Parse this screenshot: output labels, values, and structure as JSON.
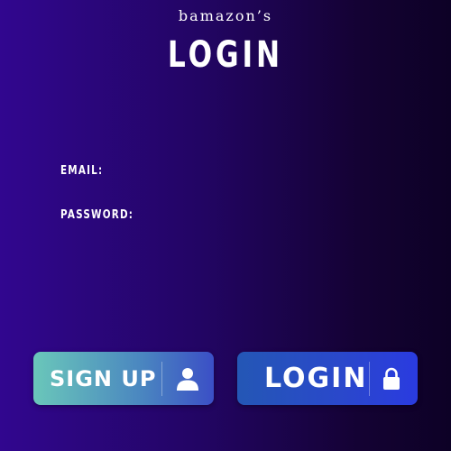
{
  "header": {
    "brand": "bamazon’s",
    "title": "LOGIN"
  },
  "form": {
    "email_label": "EMAIL:",
    "email_value": "",
    "password_label": "PASSWORD:",
    "password_value": ""
  },
  "buttons": {
    "signup_label": "SIGN UP",
    "signup_icon": "user-icon",
    "login_label": "LOGIN",
    "login_icon": "lock-icon"
  },
  "colors": {
    "background_start": "#31068f",
    "background_end": "#0d0126",
    "signup_start": "#6ac7ba",
    "signup_end": "#3b4fc6",
    "login_start": "#2457b5",
    "login_end": "#2a3be0"
  }
}
